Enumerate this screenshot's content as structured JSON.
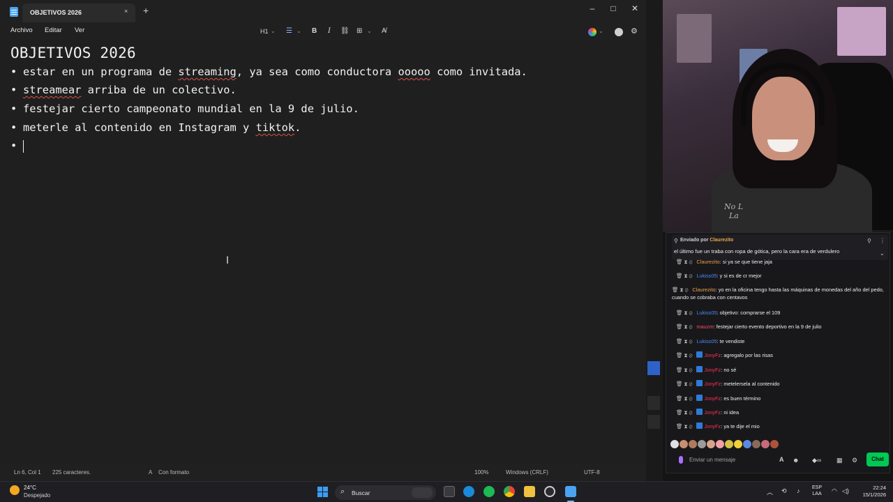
{
  "notepad": {
    "tab_title": "OBJETIVOS 2026",
    "tab_close": "×",
    "tab_new": "+",
    "window_buttons": {
      "minimize": "–",
      "maximize": "□",
      "close": "✕"
    },
    "menu": {
      "file": "Archivo",
      "edit": "Editar",
      "view": "Ver"
    },
    "toolbar": {
      "heading": "H1",
      "bold": "B",
      "italic": "I",
      "link": "⛓",
      "table": "⊞",
      "clear": "A̸",
      "chevron": "⌄"
    },
    "document": {
      "title": "OBJETIVOS 2026",
      "bullet_char": "•",
      "items": [
        [
          "estar en un programa de ",
          "streaming",
          ", ya sea como conductora ",
          "ooooo",
          " como invitada."
        ],
        [
          "",
          "streamear",
          " arriba de un colectivo."
        ],
        [
          "festejar cierto campeonato mundial en la 9 de julio."
        ],
        [
          "meterle al contenido en Instagram y ",
          "tiktok",
          "."
        ]
      ]
    },
    "status": {
      "position": "Ln 6, Col 1",
      "chars": "225 caracteres.",
      "format": "Con formato",
      "zoom": "100%",
      "line_ending": "Windows (CRLF)",
      "encoding": "UTF-8"
    }
  },
  "chat": {
    "pinned_prefix": "Enviado por ",
    "pinned_user": "Claurezito",
    "pinned_message": "el último fue un traba con ropa de gótica, pero la cara era de verdulero",
    "messages": [
      {
        "user": "Claurezito",
        "color": "#e9a64a",
        "text": ": si ya se que tiene jaja",
        "badge": false
      },
      {
        "user": "Lukiss05",
        "color": "#4b8df8",
        "text": ": y si es de cr mejor",
        "badge": false
      },
      {
        "user": "Claurezito",
        "color": "#e9a64a",
        "text": ": yo en la oficina tengo hasta las máquinas de monedas del año del pedo, cuando se cobraba con centavos",
        "badge": false
      },
      {
        "user": "Lukiss05",
        "color": "#4b8df8",
        "text": ": objetivo: comprarse el 109",
        "badge": false
      },
      {
        "user": "mauzm",
        "color": "#ff4a6b",
        "text": ": festejar cierto evento deportivo en la 9 de julio",
        "badge": false
      },
      {
        "user": "Lukiss05",
        "color": "#4b8df8",
        "text": ": te vendiste",
        "badge": false
      },
      {
        "user": "JonyFz",
        "color": "#ff3050",
        "text": ": agregalo por las risas",
        "badge": true
      },
      {
        "user": "JonyFz",
        "color": "#ff3050",
        "text": ": no sé",
        "badge": true
      },
      {
        "user": "JonyFz",
        "color": "#ff3050",
        "text": ": metelersela al contenido",
        "badge": true
      },
      {
        "user": "JonyFz",
        "color": "#ff3050",
        "text": ": es buen término",
        "badge": true
      },
      {
        "user": "JonyFz",
        "color": "#ff3050",
        "text": ": ni idea",
        "badge": true
      },
      {
        "user": "JonyFz",
        "color": "#ff3050",
        "text": ": ya te dije el mio",
        "badge": true
      }
    ],
    "input_placeholder": "Enviar un mensaje",
    "send_label": "Chat"
  },
  "taskbar": {
    "temperature": "24°C",
    "weather": "Despejado",
    "search": "Buscar",
    "lang_top": "ESP",
    "lang_bottom": "LAA",
    "time": "22:24",
    "date": "15/1/2026"
  }
}
